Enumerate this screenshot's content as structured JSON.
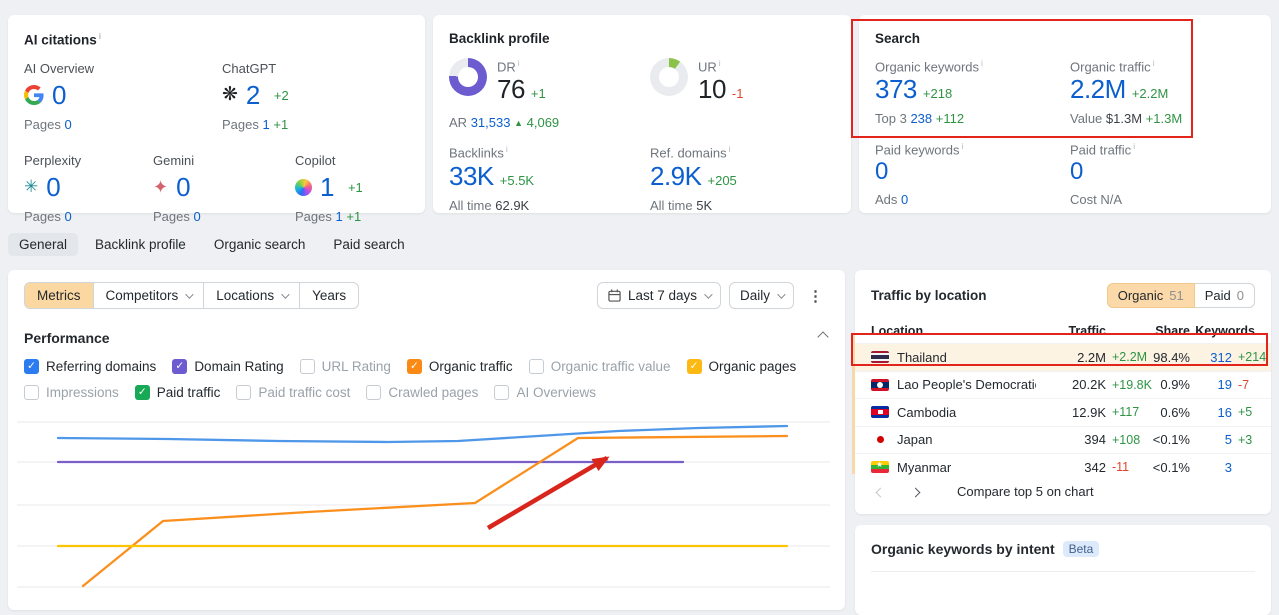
{
  "cards": {
    "ai_citations": {
      "title": "AI citations",
      "items": [
        {
          "name": "AI Overview",
          "value": "0",
          "delta": "",
          "pages_label": "Pages",
          "pages_value": "0",
          "pages_delta": ""
        },
        {
          "name": "ChatGPT",
          "value": "2",
          "delta": "+2",
          "pages_label": "Pages",
          "pages_value": "1",
          "pages_delta": "+1"
        },
        {
          "name": "Perplexity",
          "value": "0",
          "delta": "",
          "pages_label": "Pages",
          "pages_value": "0",
          "pages_delta": ""
        },
        {
          "name": "Gemini",
          "value": "0",
          "delta": "",
          "pages_label": "Pages",
          "pages_value": "0",
          "pages_delta": ""
        },
        {
          "name": "Copilot",
          "value": "1",
          "delta": "+1",
          "pages_label": "Pages",
          "pages_value": "1",
          "pages_delta": "+1"
        }
      ]
    },
    "backlink_profile": {
      "title": "Backlink profile",
      "dr": {
        "label": "DR",
        "value": "76",
        "delta": "+1",
        "percent": 76,
        "color": "#6d5bd0"
      },
      "ar": {
        "label": "AR",
        "value": "31,533",
        "delta": "4,069"
      },
      "ur": {
        "label": "UR",
        "value": "10",
        "delta": "-1",
        "percent": 10,
        "color": "#8bc34a"
      },
      "backlinks": {
        "label": "Backlinks",
        "value": "33K",
        "delta": "+5.5K",
        "alltime_label": "All time",
        "alltime_value": "62.9K"
      },
      "ref_domains": {
        "label": "Ref. domains",
        "value": "2.9K",
        "delta": "+205",
        "alltime_label": "All time",
        "alltime_value": "5K"
      }
    },
    "search": {
      "title": "Search",
      "organic_keywords": {
        "label": "Organic keywords",
        "value": "373",
        "delta": "+218",
        "sub_label": "Top 3",
        "sub_value": "238",
        "sub_delta": "+112"
      },
      "organic_traffic": {
        "label": "Organic traffic",
        "value": "2.2M",
        "delta": "+2.2M",
        "sub_label": "Value",
        "sub_value": "$1.3M",
        "sub_delta": "+1.3M"
      },
      "paid_keywords": {
        "label": "Paid keywords",
        "value": "0",
        "sub_label": "Ads",
        "sub_value": "0"
      },
      "paid_traffic": {
        "label": "Paid traffic",
        "value": "0",
        "sub_label": "Cost",
        "sub_value": "N/A"
      }
    }
  },
  "tabs": [
    {
      "label": "General",
      "active": true
    },
    {
      "label": "Backlink profile",
      "active": false
    },
    {
      "label": "Organic search",
      "active": false
    },
    {
      "label": "Paid search",
      "active": false
    }
  ],
  "filters": {
    "segments": [
      {
        "label": "Metrics",
        "active": true,
        "chevron": false
      },
      {
        "label": "Competitors",
        "active": false,
        "chevron": true
      },
      {
        "label": "Locations",
        "active": false,
        "chevron": true
      },
      {
        "label": "Years",
        "active": false,
        "chevron": false
      }
    ],
    "date_range": "Last 7 days",
    "granularity": "Daily"
  },
  "performance": {
    "title": "Performance",
    "checkboxes": [
      {
        "label": "Referring domains",
        "checked": true,
        "color": "#2b7cf0"
      },
      {
        "label": "Domain Rating",
        "checked": true,
        "color": "#6d5bd0"
      },
      {
        "label": "URL Rating",
        "checked": false,
        "color": ""
      },
      {
        "label": "Organic traffic",
        "checked": true,
        "color": "#fa8a15"
      },
      {
        "label": "Organic traffic value",
        "checked": false,
        "color": ""
      },
      {
        "label": "Organic pages",
        "checked": true,
        "color": "#fdb913"
      },
      {
        "label": "Impressions",
        "checked": false,
        "color": ""
      },
      {
        "label": "Paid traffic",
        "checked": true,
        "color": "#18a957"
      },
      {
        "label": "Paid traffic cost",
        "checked": false,
        "color": ""
      },
      {
        "label": "Crawled pages",
        "checked": false,
        "color": ""
      },
      {
        "label": "AI Overviews",
        "checked": false,
        "color": ""
      }
    ]
  },
  "chart_data": {
    "type": "line",
    "note": "Performance trend, last 7 days, daily; axis labels cropped out of view. Points are SVG px coords (837x200 canvas).",
    "gridlines_y": [
      32,
      72,
      115,
      156,
      197
    ],
    "series": [
      {
        "name": "Referring domains",
        "color": "#4f97e8",
        "points": [
          [
            50,
            48
          ],
          [
            160,
            49
          ],
          [
            270,
            51
          ],
          [
            380,
            52
          ],
          [
            450,
            51
          ],
          [
            530,
            46
          ],
          [
            610,
            41
          ],
          [
            690,
            38
          ],
          [
            779,
            36
          ]
        ]
      },
      {
        "name": "Domain Rating",
        "color": "#7a5fc6",
        "points": [
          [
            50,
            72
          ],
          [
            675,
            72
          ]
        ]
      },
      {
        "name": "Organic traffic",
        "color": "#fb8f1d",
        "points": [
          [
            75,
            196
          ],
          [
            155,
            131
          ],
          [
            300,
            122
          ],
          [
            467,
            113
          ],
          [
            570,
            48
          ],
          [
            779,
            46
          ]
        ]
      },
      {
        "name": "Organic pages",
        "color": "#fdc500",
        "points": [
          [
            50,
            156
          ],
          [
            779,
            156
          ]
        ]
      }
    ],
    "annotation_arrow": {
      "from": [
        480,
        138
      ],
      "to": [
        599,
        68
      ],
      "color": "#d8261d"
    }
  },
  "traffic_by_location": {
    "title": "Traffic by location",
    "toggle": [
      {
        "label": "Organic",
        "count": "51",
        "active": true
      },
      {
        "label": "Paid",
        "count": "0",
        "active": false
      }
    ],
    "columns": [
      "Location",
      "Traffic",
      "Share",
      "Keywords"
    ],
    "rows": [
      {
        "location": "Thailand",
        "flag": "th",
        "traffic": "2.2M",
        "traffic_delta": "+2.2M",
        "share": "98.4%",
        "keywords": "312",
        "kw_delta": "+214",
        "highlighted": true
      },
      {
        "location": "Lao People's Democratic Reput",
        "flag": "la",
        "traffic": "20.2K",
        "traffic_delta": "+19.8K",
        "share": "0.9%",
        "keywords": "19",
        "kw_delta": "-7",
        "highlighted": false
      },
      {
        "location": "Cambodia",
        "flag": "kh",
        "traffic": "12.9K",
        "traffic_delta": "+117",
        "share": "0.6%",
        "keywords": "16",
        "kw_delta": "+5",
        "highlighted": false
      },
      {
        "location": "Japan",
        "flag": "jp",
        "traffic": "394",
        "traffic_delta": "+108",
        "share": "<0.1%",
        "keywords": "5",
        "kw_delta": "+3",
        "highlighted": false
      },
      {
        "location": "Myanmar",
        "flag": "mm",
        "traffic": "342",
        "traffic_delta": "-11",
        "share": "<0.1%",
        "keywords": "3",
        "kw_delta": "",
        "highlighted": false
      }
    ],
    "footer": "Compare top 5 on chart"
  },
  "intent_panel": {
    "title": "Organic keywords by intent",
    "badge": "Beta"
  }
}
